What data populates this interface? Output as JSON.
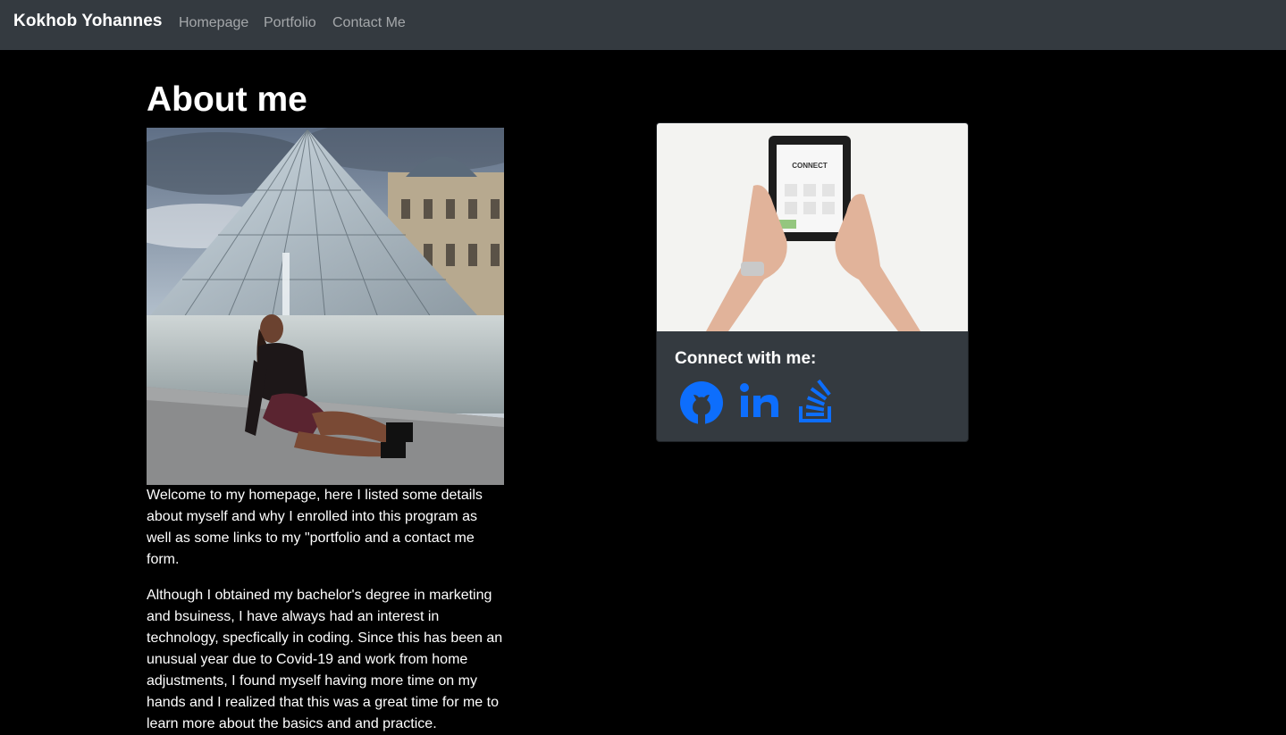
{
  "nav": {
    "brand": "Kokhob Yohannes",
    "links": [
      "Homepage",
      "Portfolio",
      "Contact Me"
    ]
  },
  "main": {
    "title": "About me",
    "paragraphs": [
      "Welcome to my homepage, here I listed some details about myself and why I enrolled into this program as well as some links to my \"portfolio and a contact me form.",
      "Although I obtained my bachelor's degree in marketing and bsuiness, I have always had an interest in technology, specfically in coding. Since this has been an unusual year due to Covid-19 and work from home adjustments, I found myself having more time on my hands and I realized that this was a great time for me to learn more about the basics and and practice."
    ]
  },
  "card": {
    "title": "Connect with me:",
    "tablet_text": "CONNECT",
    "icons": [
      "github-icon",
      "linkedin-icon",
      "stackoverflow-icon"
    ]
  },
  "colors": {
    "navbar": "#343a40",
    "background": "#000000",
    "card": "#343a40",
    "accent": "#0d6efd"
  }
}
